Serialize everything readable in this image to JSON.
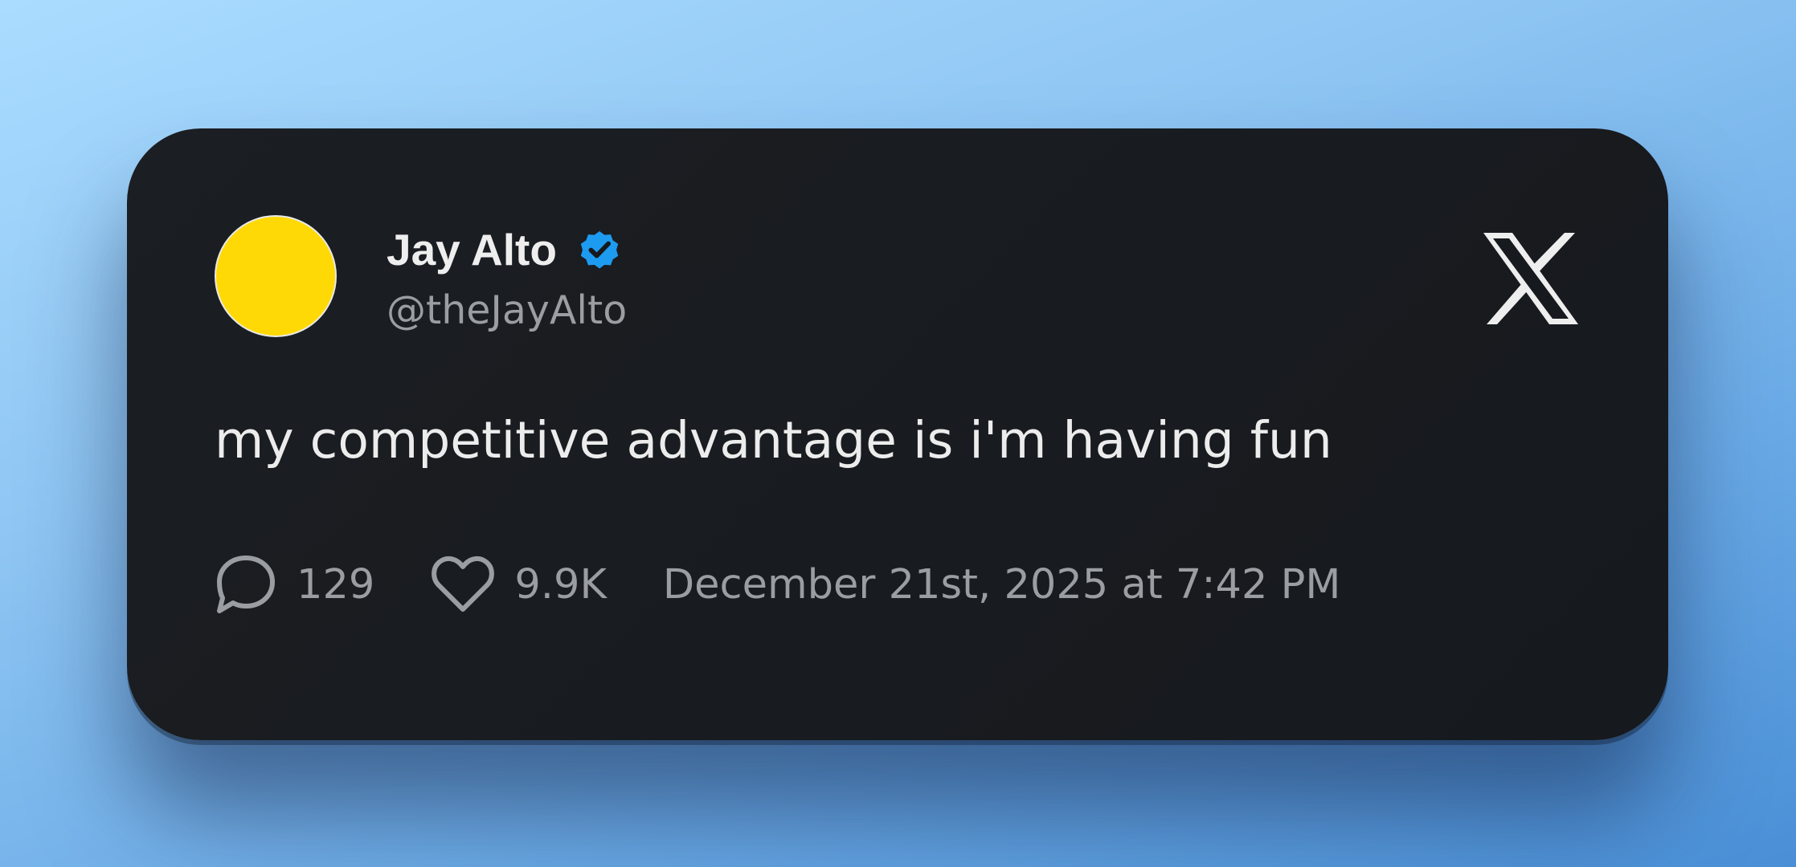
{
  "colors": {
    "avatar_fill": "#ffd905",
    "verified_badge": "#1d9bf0",
    "card_background": "#181b1f"
  },
  "author": {
    "name": "Jay Alto",
    "handle": "@theJayAlto",
    "verified": true,
    "avatar_icon": "yellow-circle-avatar"
  },
  "tweet": {
    "text": "my competitive advantage is i'm having fun",
    "replies": "129",
    "likes": "9.9K",
    "timestamp": "December 21st, 2025 at 7:42 PM"
  },
  "icons": {
    "brand": "x-logo-icon",
    "reply": "speech-bubble-icon",
    "like": "heart-icon",
    "verified": "verified-badge-icon"
  }
}
